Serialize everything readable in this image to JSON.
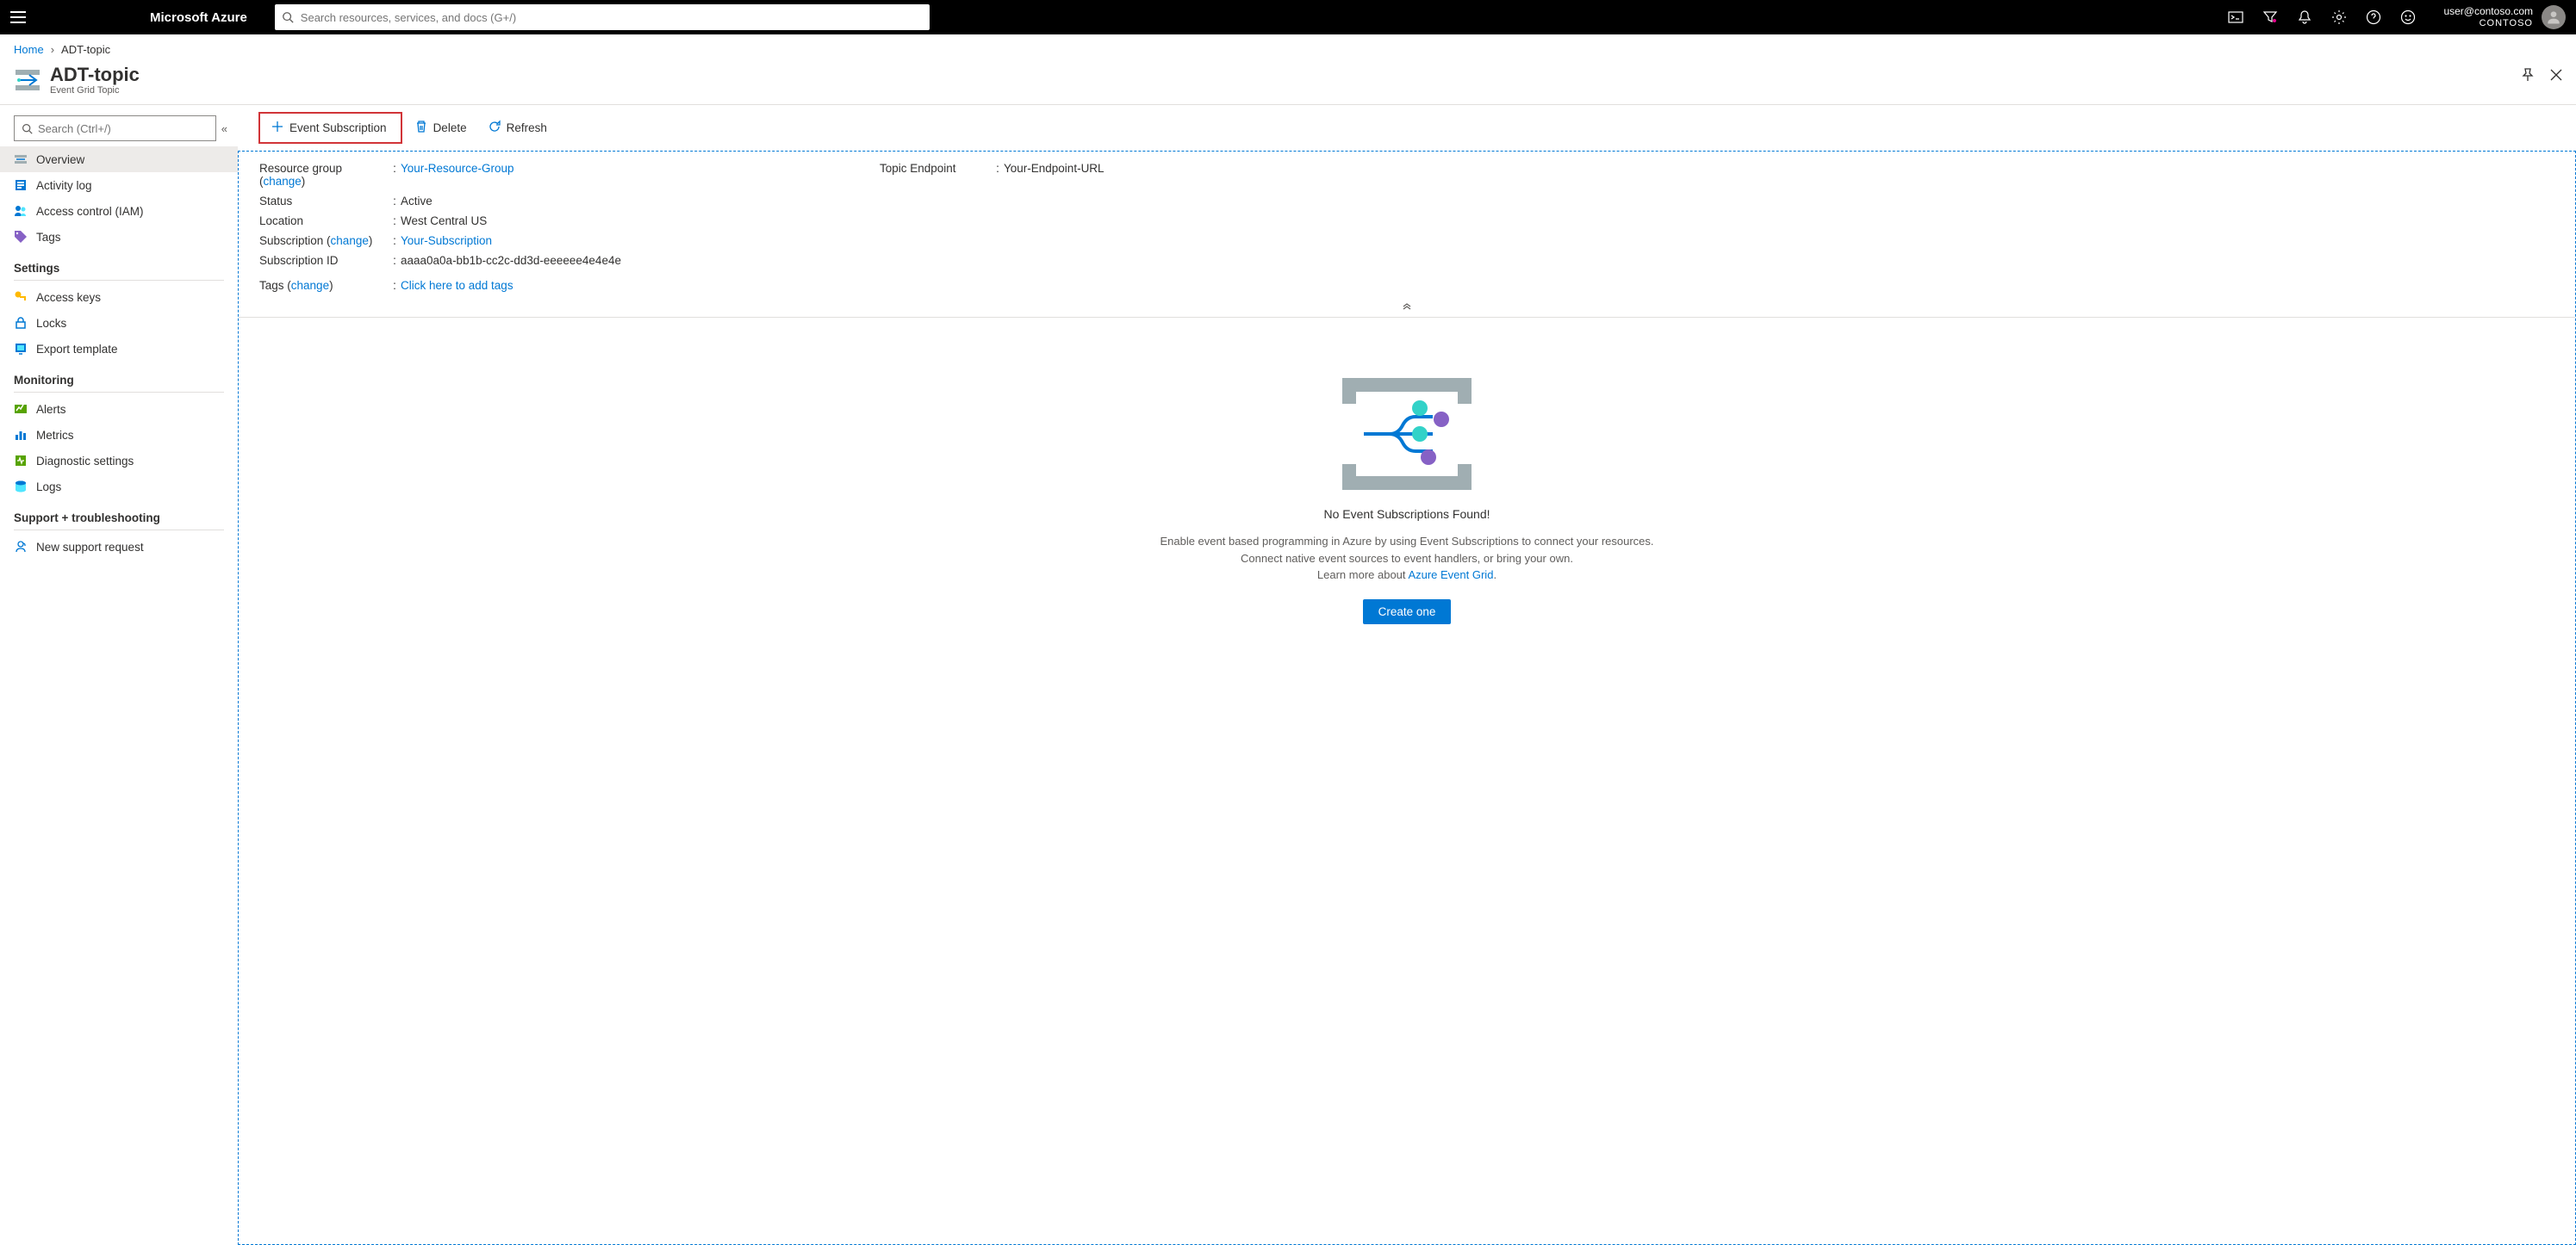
{
  "topbar": {
    "brand": "Microsoft Azure",
    "search_placeholder": "Search resources, services, and docs (G+/)",
    "user_email": "user@contoso.com",
    "tenant": "CONTOSO"
  },
  "breadcrumb": {
    "home": "Home",
    "current": "ADT-topic"
  },
  "resource": {
    "title": "ADT-topic",
    "subtitle": "Event Grid Topic"
  },
  "sidebar": {
    "search_placeholder": "Search (Ctrl+/)",
    "items": {
      "overview": "Overview",
      "activity_log": "Activity log",
      "access_control": "Access control (IAM)",
      "tags": "Tags"
    },
    "section_settings": "Settings",
    "settings_items": {
      "access_keys": "Access keys",
      "locks": "Locks",
      "export_template": "Export template"
    },
    "section_monitoring": "Monitoring",
    "monitoring_items": {
      "alerts": "Alerts",
      "metrics": "Metrics",
      "diagnostic": "Diagnostic settings",
      "logs": "Logs"
    },
    "section_support": "Support + troubleshooting",
    "support_items": {
      "new_support": "New support request"
    }
  },
  "toolbar": {
    "event_subscription": "Event Subscription",
    "delete": "Delete",
    "refresh": "Refresh"
  },
  "essentials": {
    "resource_group_label": "Resource group",
    "change": "change",
    "resource_group_value": "Your-Resource-Group",
    "status_label": "Status",
    "status_value": "Active",
    "location_label": "Location",
    "location_value": "West Central US",
    "subscription_label": "Subscription",
    "subscription_value": "Your-Subscription",
    "subscription_id_label": "Subscription ID",
    "subscription_id_value": "aaaa0a0a-bb1b-cc2c-dd3d-eeeeee4e4e4e",
    "tags_label": "Tags",
    "tags_value": "Click here to add tags",
    "topic_endpoint_label": "Topic Endpoint",
    "topic_endpoint_value": "Your-Endpoint-URL"
  },
  "empty": {
    "title": "No Event Subscriptions Found!",
    "desc1": "Enable event based programming in Azure by using Event Subscriptions to connect your resources.",
    "desc2": "Connect native event sources to event handlers, or bring your own.",
    "desc3_prefix": "Learn more about ",
    "desc3_link": "Azure Event Grid",
    "create": "Create one"
  }
}
